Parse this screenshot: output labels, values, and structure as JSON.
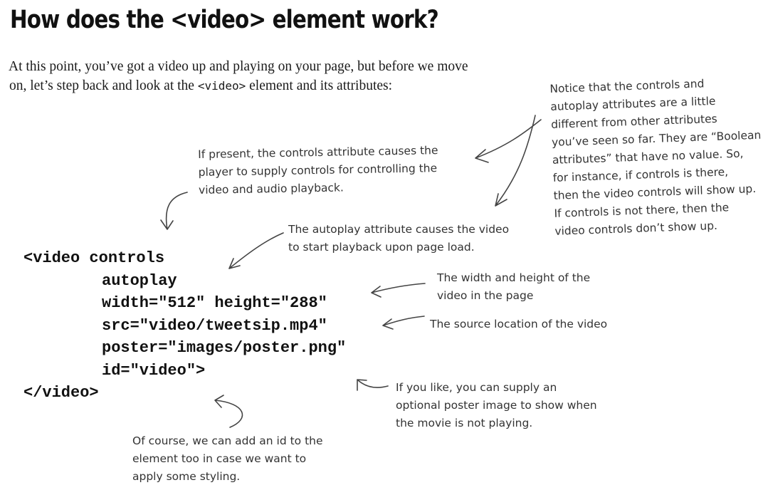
{
  "title": "How does the <video> element work?",
  "intro": {
    "line1": "At this point, you’ve got a video up and playing on your page, but before we move",
    "line2_before": "on, let’s step back and look at the ",
    "line2_code": "<video>",
    "line2_after": " element and its attributes:"
  },
  "code": {
    "line1": "<video controls",
    "line2": "autoplay",
    "line3": "width=\"512\" height=\"288\"",
    "line4": "src=\"video/tweetsip.mp4\"",
    "line5": "poster=\"images/poster.png\"",
    "line6": "id=\"video\">",
    "line7": "</video>"
  },
  "annotations": {
    "boolean": [
      "Notice that the controls and",
      "autoplay attributes are a little",
      "different from other attributes",
      "you’ve seen so far. They are “Boolean",
      "attributes” that have no value. So,",
      "for instance, if controls is there,",
      "then the video controls will show up.",
      "If controls is not there, then the",
      "video controls don’t show up."
    ],
    "controls": [
      "If present, the controls attribute causes the",
      "player to supply controls for controlling the",
      "video and audio playback."
    ],
    "autoplay": [
      "The autoplay attribute causes the video",
      "to start playback upon page load."
    ],
    "size": [
      "The width and height of the",
      "video in the page"
    ],
    "source": [
      "The source location of the video"
    ],
    "poster": [
      "If you like, you can supply an",
      "optional poster image to show when",
      "the movie is not playing."
    ],
    "id": [
      "Of course, we can add an id to the",
      "element too in case we want to",
      "apply some styling."
    ]
  }
}
